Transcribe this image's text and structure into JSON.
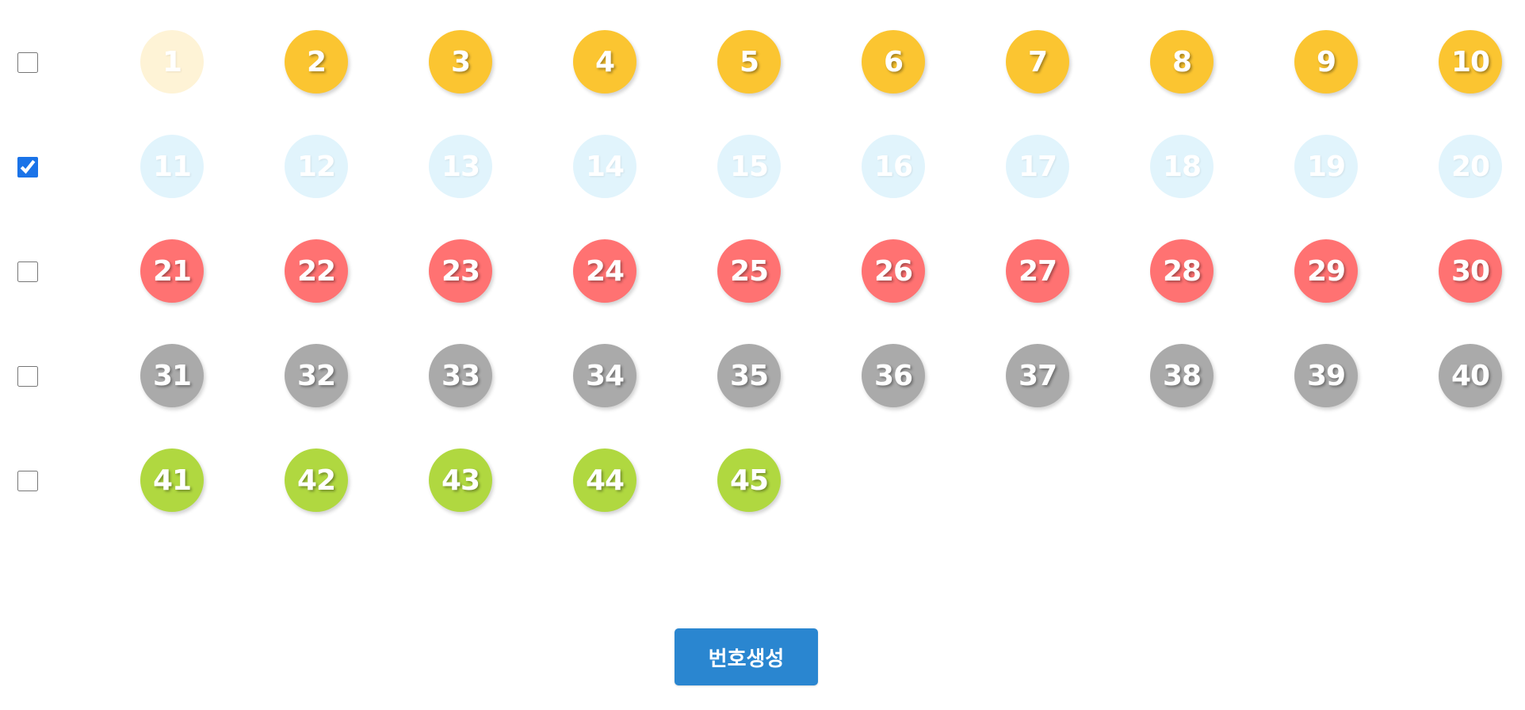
{
  "rows": [
    {
      "checked": false,
      "color": "#fbc531",
      "numbers": [
        1,
        2,
        3,
        4,
        5,
        6,
        7,
        8,
        9,
        10
      ],
      "faded_numbers": [
        1
      ]
    },
    {
      "checked": true,
      "color": "#69c8f2",
      "numbers": [
        11,
        12,
        13,
        14,
        15,
        16,
        17,
        18,
        19,
        20
      ],
      "faded_numbers": [
        11,
        12,
        13,
        14,
        15,
        16,
        17,
        18,
        19,
        20
      ]
    },
    {
      "checked": false,
      "color": "#ff7272",
      "numbers": [
        21,
        22,
        23,
        24,
        25,
        26,
        27,
        28,
        29,
        30
      ],
      "faded_numbers": []
    },
    {
      "checked": false,
      "color": "#aaaaaa",
      "numbers": [
        31,
        32,
        33,
        34,
        35,
        36,
        37,
        38,
        39,
        40
      ],
      "faded_numbers": []
    },
    {
      "checked": false,
      "color": "#b0d840",
      "numbers": [
        41,
        42,
        43,
        44,
        45
      ],
      "faded_numbers": []
    }
  ],
  "generate_button": {
    "label": "번호생성",
    "color": "#2a86d0"
  }
}
